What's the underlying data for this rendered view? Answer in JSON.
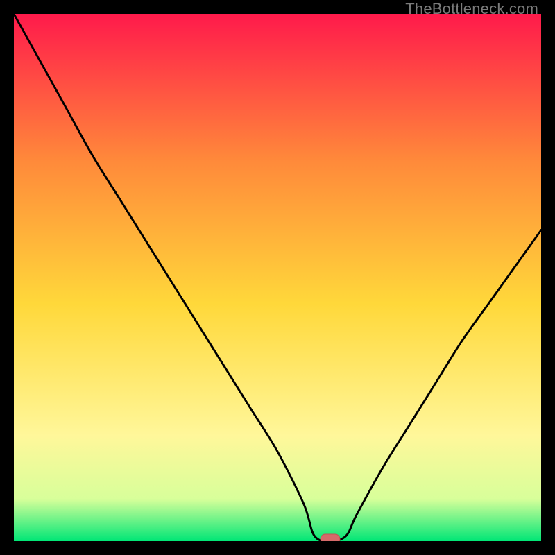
{
  "watermark": "TheBottleneck.com",
  "chart_data": {
    "type": "line",
    "title": "",
    "xlabel": "",
    "ylabel": "",
    "xlim": [
      0,
      100
    ],
    "ylim": [
      0,
      100
    ],
    "x": [
      0,
      5,
      10,
      15,
      20,
      25,
      30,
      35,
      40,
      45,
      50,
      55,
      57,
      60,
      63,
      65,
      70,
      75,
      80,
      85,
      90,
      95,
      100
    ],
    "values": [
      100,
      91,
      82,
      73,
      65,
      57,
      49,
      41,
      33,
      25,
      17,
      7,
      1,
      0,
      1,
      5,
      14,
      22,
      30,
      38,
      45,
      52,
      59
    ],
    "minimum_marker": {
      "x": 60,
      "y": 0
    },
    "background": "red-yellow-green vertical gradient",
    "grid": false,
    "legend": false
  },
  "colors": {
    "gradient_top": "#ff1a4b",
    "gradient_mid1": "#ff8a3a",
    "gradient_mid2": "#ffd83a",
    "gradient_mid3": "#fff79a",
    "gradient_mid4": "#d8ff9a",
    "gradient_bottom": "#00e676",
    "curve": "#000000",
    "marker_fill": "#d66a6a",
    "marker_stroke": "#c25555",
    "frame": "#000000"
  }
}
